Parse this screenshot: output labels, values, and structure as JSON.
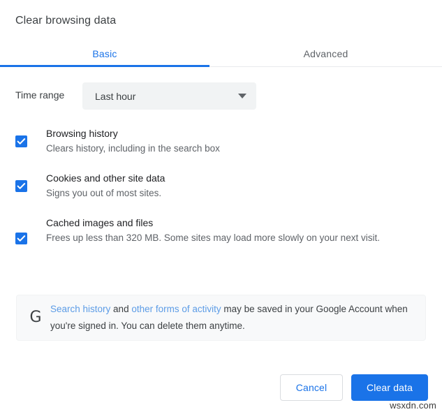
{
  "dialog": {
    "title": "Clear browsing data"
  },
  "tabs": [
    {
      "id": "basic",
      "label": "Basic",
      "active": true
    },
    {
      "id": "advanced",
      "label": "Advanced",
      "active": false
    }
  ],
  "time_range": {
    "label": "Time range",
    "selected": "Last hour",
    "arrow_icon": "chevron-down-icon"
  },
  "options": [
    {
      "id": "browsing-history",
      "title": "Browsing history",
      "description": "Clears history, including in the search box",
      "checked": true
    },
    {
      "id": "cookies-site-data",
      "title": "Cookies and other site data",
      "description": "Signs you out of most sites.",
      "checked": true
    },
    {
      "id": "cached-images-files",
      "title": "Cached images and files",
      "description": "Frees up less than 320 MB. Some sites may load more slowly on your next visit.",
      "checked": true
    }
  ],
  "info_card": {
    "icon": "google-g-icon",
    "link1": "Search history",
    "between": " and ",
    "link2": "other forms of activity",
    "rest": " may be saved in your Google Account when you're signed in. You can delete them anytime."
  },
  "footer": {
    "cancel_label": "Cancel",
    "clear_label": "Clear data"
  },
  "watermark": {
    "text": "wsxdn.com"
  },
  "colors": {
    "accent": "#1a73e8",
    "tab_inactive": "#5f6368",
    "select_bg": "#f1f3f4",
    "card_bg": "#f8f9fa",
    "link": "#5c9ce6",
    "text_primary": "#202124",
    "text_secondary": "#5f6368"
  }
}
